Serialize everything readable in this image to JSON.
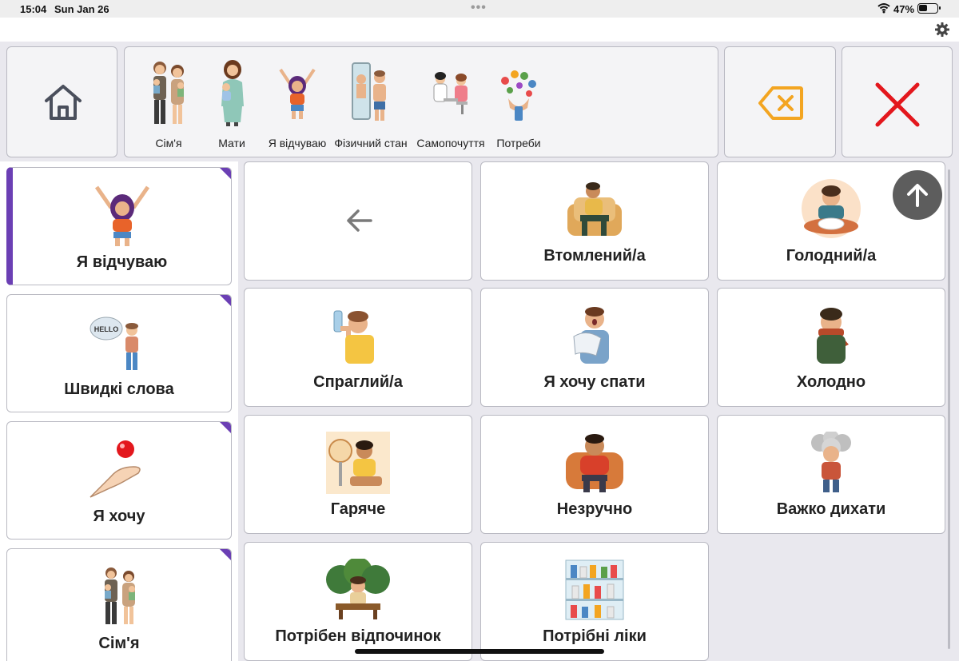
{
  "status_bar": {
    "time": "15:04",
    "date": "Sun Jan 26",
    "battery": "47%"
  },
  "toolbar": {
    "categories": [
      {
        "label": "Сім'я",
        "icon": "family-icon"
      },
      {
        "label": "Мати",
        "icon": "mother-icon"
      },
      {
        "label": "Я відчуваю",
        "icon": "i-feel-icon"
      },
      {
        "label": "Фізичний стан",
        "icon": "physical-state-icon"
      },
      {
        "label": "Самопочуття",
        "icon": "wellbeing-icon"
      },
      {
        "label": "Потреби",
        "icon": "needs-icon"
      }
    ]
  },
  "sidebar": {
    "items": [
      {
        "label": "Я відчуваю",
        "icon": "i-feel-icon"
      },
      {
        "label": "Швидкі слова",
        "icon": "quick-words-icon"
      },
      {
        "label": "Я хочу",
        "icon": "i-want-icon"
      },
      {
        "label": "Сім'я",
        "icon": "family-icon"
      }
    ]
  },
  "grid": {
    "tiles": [
      {
        "label": "Втомлений/а",
        "icon": "tired-icon"
      },
      {
        "label": "Голодний/а",
        "icon": "hungry-icon"
      },
      {
        "label": "Спраглий/а",
        "icon": "thirsty-icon"
      },
      {
        "label": "Я хочу спати",
        "icon": "sleepy-icon"
      },
      {
        "label": "Холодно",
        "icon": "cold-icon"
      },
      {
        "label": "Гаряче",
        "icon": "hot-icon"
      },
      {
        "label": "Незручно",
        "icon": "uncomfortable-icon"
      },
      {
        "label": "Важко дихати",
        "icon": "hard-to-breathe-icon"
      },
      {
        "label": "Потрібен відпочинок",
        "icon": "need-rest-icon"
      },
      {
        "label": "Потрібні ліки",
        "icon": "need-medicine-icon"
      }
    ]
  },
  "colors": {
    "accent": "#6b3fb4",
    "backspace": "#f3a521",
    "close": "#e3171d",
    "scroll_button": "#5d5d5d"
  }
}
